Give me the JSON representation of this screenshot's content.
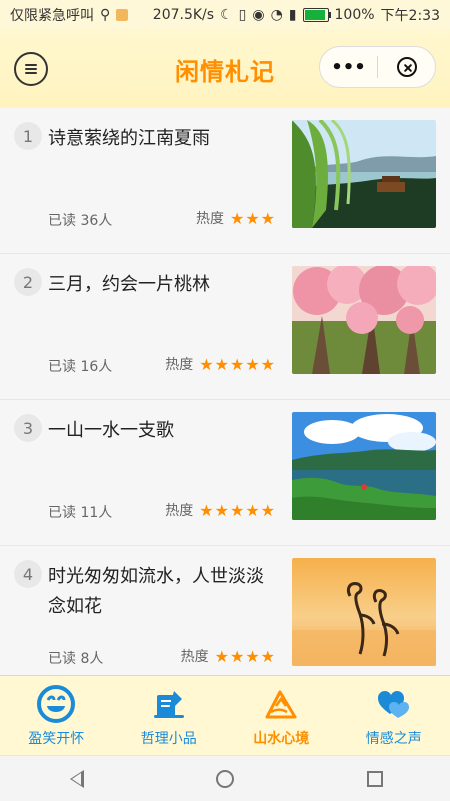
{
  "status_bar": {
    "carrier_text": "仅限紧急呼叫",
    "network_speed": "207.5K/s",
    "battery": "100%",
    "time": "下午2:33"
  },
  "header": {
    "title": "闲情札记",
    "more_label": "•••"
  },
  "articles": [
    {
      "index": "1",
      "title": "诗意萦绕的江南夏雨",
      "read": "已读 36人",
      "heat_label": "热度",
      "stars": "★★★",
      "rating": 3,
      "image_name": "willow-lake-photo"
    },
    {
      "index": "2",
      "title": "三月，约会一片桃林",
      "read": "已读 16人",
      "heat_label": "热度",
      "stars": "★★★★★",
      "rating": 5,
      "image_name": "peach-blossom-photo"
    },
    {
      "index": "3",
      "title": "一山一水一支歌",
      "read": "已读 11人",
      "heat_label": "热度",
      "stars": "★★★★★",
      "rating": 5,
      "image_name": "lake-islands-photo"
    },
    {
      "index": "4",
      "title": "时光匆匆如流水，人世淡淡念如花",
      "read": "已读 8人",
      "heat_label": "热度",
      "stars": "★★★★",
      "rating": 4,
      "image_name": "flamingo-sunset-photo"
    }
  ],
  "tabs": [
    {
      "label": "盈笑开怀",
      "icon": "smile-icon",
      "active": false
    },
    {
      "label": "哲理小品",
      "icon": "notebook-icon",
      "active": false
    },
    {
      "label": "山水心境",
      "icon": "mountain-icon",
      "active": true
    },
    {
      "label": "情感之声",
      "icon": "hearts-icon",
      "active": false
    }
  ],
  "colors": {
    "accent": "#ff8f00",
    "tab_blue": "#1b8bd8",
    "header_bg": "#fff7cf"
  }
}
